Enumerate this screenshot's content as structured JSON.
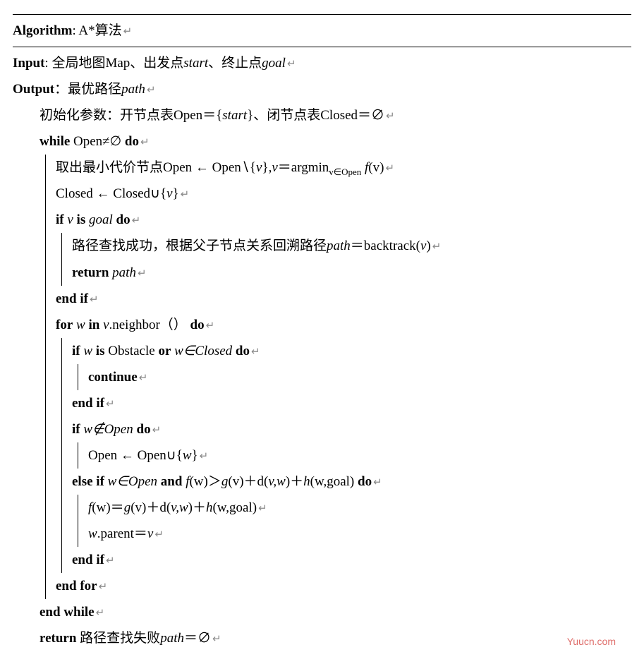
{
  "title_kw": "Algorithm",
  "title_rest": ": A*算法",
  "input_kw": "Input",
  "input_rest": ": 全局地图Map、出发点",
  "input_start": "start",
  "input_mid": "、终止点",
  "input_goal": "goal",
  "output_kw": "Output",
  "output_rest": "：最优路径",
  "output_var": "path",
  "init": "初始化参数：开节点表Open＝{",
  "init_start": "start",
  "init_rest": "}、闭节点表Closed＝∅",
  "while_kw": "while",
  "while_cond": " Open≠∅ ",
  "do_kw": "do",
  "pop_txt": "取出最小代价节点Open ← Open∖{",
  "pop_v": "v",
  "pop_mid": "},",
  "pop_v2": "v",
  "pop_eq": "＝argmin",
  "pop_sub": "v∈Open",
  "pop_f": " f",
  "pop_fv": "(v)",
  "closed_line": "Closed ← Closed∪{",
  "closed_v": "v",
  "closed_end": "}",
  "if_kw": "if",
  "if_v": " v ",
  "is_kw": "is",
  "if_goal": " goal ",
  "found_txt": "路径查找成功，根据父子节点关系回溯路径",
  "found_path": "path",
  "found_eq": "＝backtrack(",
  "found_v": "v",
  "found_close": ")",
  "return_kw": "return",
  "return_path": " path",
  "endif_kw": "end if",
  "for_kw": "for",
  "for_w": " w ",
  "in_kw": "in",
  "for_v": " v",
  "for_neighbor": ".neighbor（）",
  "if2_w": " w ",
  "if2_obst": " Obstacle ",
  "or_kw": "or",
  "if2_cond2": " w∈Closed ",
  "continue_kw": "continue",
  "if3_cond": " w∉Open ",
  "open_add": "Open ← Open∪{",
  "open_w": "w",
  "open_end": "}",
  "elseif_kw": "else if",
  "elif_cond1": " w∈Open ",
  "and_kw": "and",
  "elif_f": " f",
  "elif_fw": "(w)",
  "elif_gt": "＞",
  "elif_g": "g",
  "elif_gv": "(v)",
  "elif_plus1": "＋d(",
  "elif_vw": "v,w",
  "elif_plus2": ")＋",
  "elif_h": "h",
  "elif_hw": "(w,goal) ",
  "upd_f": "f",
  "upd_fw": "(w)",
  "upd_eq": "＝",
  "upd_g": "g",
  "upd_gv": "(v)",
  "upd_plus1": "＋d(",
  "upd_vw": "v,w",
  "upd_plus2": ")＋",
  "upd_h": "h",
  "upd_hw": "(w,goal)",
  "parent_w": "w",
  "parent_txt": ".parent＝",
  "parent_v": "v",
  "endfor_kw": "end for",
  "endwhile_kw": "end while",
  "fail_txt": " 路径查找失败",
  "fail_path": "path",
  "fail_eq": "＝∅",
  "ret_sym": "↵",
  "watermark": "Yuucn.com"
}
